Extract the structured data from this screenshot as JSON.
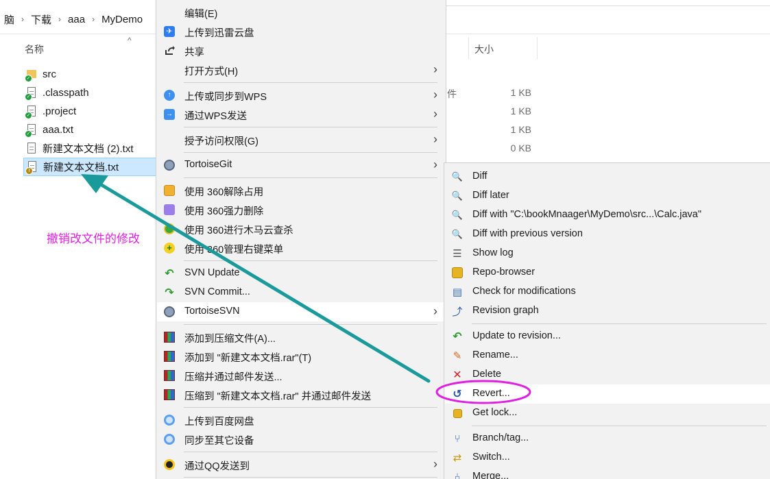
{
  "explorer": {
    "breadcrumb": [
      "脑",
      "下载",
      "aaa",
      "MyDemo"
    ],
    "column_name": "名称",
    "column_size": "大小",
    "type_fragment": "件",
    "files": [
      {
        "name": "src",
        "kind": "folder",
        "status": "ok"
      },
      {
        "name": ".classpath",
        "kind": "doc",
        "status": "ok"
      },
      {
        "name": ".project",
        "kind": "doc",
        "status": "ok"
      },
      {
        "name": "aaa.txt",
        "kind": "doc",
        "status": "ok"
      },
      {
        "name": "新建文本文档 (2).txt",
        "kind": "doc",
        "status": "none"
      },
      {
        "name": "新建文本文档.txt",
        "kind": "doc",
        "status": "modified",
        "selected": true
      }
    ],
    "sizes": [
      "1 KB",
      "1 KB",
      "1 KB",
      "0 KB"
    ]
  },
  "annotation": {
    "text": "撤销改文件的修改",
    "color": "#e020e0",
    "arrow_color": "#1a9a9a"
  },
  "context_menu": {
    "items": [
      {
        "label": "编辑(E)",
        "icon": "none",
        "submenu": false
      },
      {
        "label": "上传到迅雷云盘",
        "icon": "thunder-cloud-icon",
        "submenu": false
      },
      {
        "label": "共享",
        "icon": "share-icon",
        "submenu": false
      },
      {
        "label": "打开方式(H)",
        "icon": "none",
        "submenu": true
      },
      {
        "label": "上传或同步到WPS",
        "icon": "wps-cloud-icon",
        "submenu": true
      },
      {
        "label": "通过WPS发送",
        "icon": "wps-send-icon",
        "submenu": true
      },
      {
        "label": "授予访问权限(G)",
        "icon": "none",
        "submenu": true
      },
      {
        "label": "TortoiseGit",
        "icon": "tortoisegit-icon",
        "submenu": true
      },
      {
        "label": "使用 360解除占用",
        "icon": "360-unlock-icon",
        "submenu": false
      },
      {
        "label": "使用 360强力删除",
        "icon": "360-shred-icon",
        "submenu": false
      },
      {
        "label": "使用 360进行木马云查杀",
        "icon": "360-scan-icon",
        "submenu": false
      },
      {
        "label": "使用 360管理右键菜单",
        "icon": "360-menu-icon",
        "submenu": false
      },
      {
        "label": "SVN Update",
        "icon": "svn-update-icon",
        "submenu": false
      },
      {
        "label": "SVN Commit...",
        "icon": "svn-commit-icon",
        "submenu": false
      },
      {
        "label": "TortoiseSVN",
        "icon": "tortoisesvn-icon",
        "submenu": true
      },
      {
        "label": "添加到压缩文件(A)...",
        "icon": "winrar-icon",
        "submenu": false
      },
      {
        "label": "添加到 \"新建文本文档.rar\"(T)",
        "icon": "winrar-icon",
        "submenu": false
      },
      {
        "label": "压缩并通过邮件发送...",
        "icon": "winrar-icon",
        "submenu": false
      },
      {
        "label": "压缩到 \"新建文本文档.rar\" 并通过邮件发送",
        "icon": "winrar-icon",
        "submenu": false
      },
      {
        "label": "上传到百度网盘",
        "icon": "baidu-cloud-icon",
        "submenu": false
      },
      {
        "label": "同步至其它设备",
        "icon": "baidu-sync-icon",
        "submenu": false
      },
      {
        "label": "通过QQ发送到",
        "icon": "qq-icon",
        "submenu": true
      }
    ]
  },
  "svn_submenu": {
    "items": [
      {
        "label": "Diff",
        "icon": "diff-icon"
      },
      {
        "label": "Diff later",
        "icon": "diff-later-icon"
      },
      {
        "label": "Diff with \"C:\\bookMnaager\\MyDemo\\src...\\Calc.java\"",
        "icon": "diff-with-icon"
      },
      {
        "label": "Diff with previous version",
        "icon": "diff-previous-icon"
      },
      {
        "label": "Show log",
        "icon": "show-log-icon"
      },
      {
        "label": "Repo-browser",
        "icon": "repo-browser-icon"
      },
      {
        "label": "Check for modifications",
        "icon": "check-modifications-icon"
      },
      {
        "label": "Revision graph",
        "icon": "revision-graph-icon"
      },
      {
        "label": "Update to revision...",
        "icon": "update-revision-icon"
      },
      {
        "label": "Rename...",
        "icon": "rename-icon"
      },
      {
        "label": "Delete",
        "icon": "delete-icon"
      },
      {
        "label": "Revert...",
        "icon": "revert-icon"
      },
      {
        "label": "Get lock...",
        "icon": "lock-icon"
      },
      {
        "label": "Branch/tag...",
        "icon": "branch-icon"
      },
      {
        "label": "Switch...",
        "icon": "switch-icon"
      },
      {
        "label": "Merge...",
        "icon": "merge-icon"
      }
    ]
  }
}
